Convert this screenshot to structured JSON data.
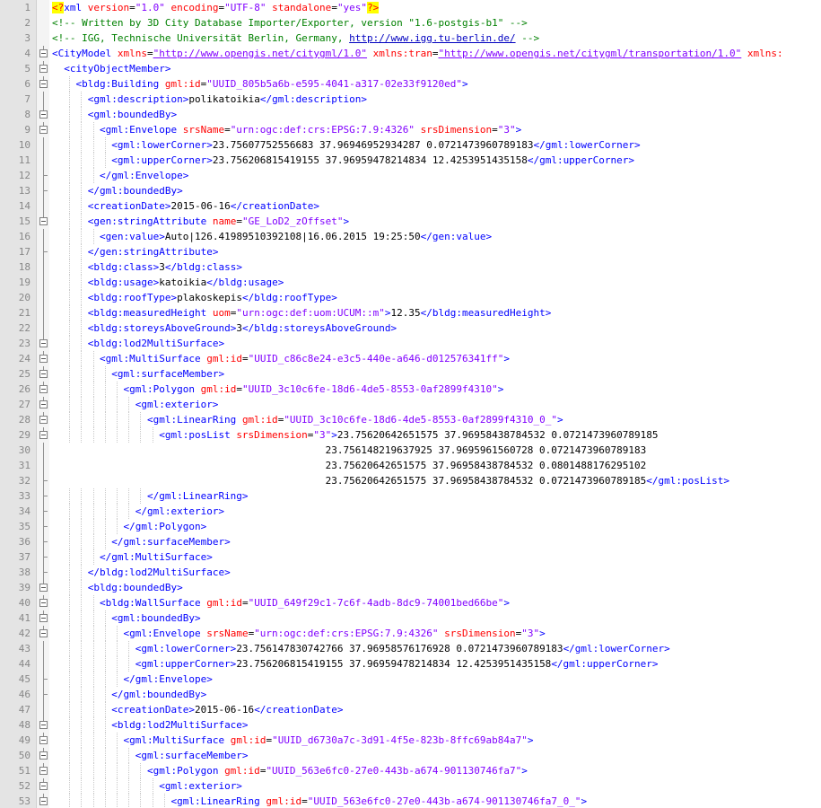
{
  "editor": {
    "lines": [
      {
        "n": "1",
        "fold": "",
        "indent": 0,
        "tokens": [
          {
            "t": "pi",
            "v": "<?"
          },
          {
            "t": "tag",
            "v": "xml "
          },
          {
            "t": "attr",
            "v": "version"
          },
          {
            "t": "txt",
            "v": "="
          },
          {
            "t": "val",
            "v": "\"1.0\""
          },
          {
            "t": "attr",
            "v": " encoding"
          },
          {
            "t": "txt",
            "v": "="
          },
          {
            "t": "val",
            "v": "\"UTF-8\""
          },
          {
            "t": "attr",
            "v": " standalone"
          },
          {
            "t": "txt",
            "v": "="
          },
          {
            "t": "val",
            "v": "\"yes\""
          },
          {
            "t": "pi",
            "v": "?>"
          }
        ]
      },
      {
        "n": "2",
        "fold": "",
        "indent": 0,
        "tokens": [
          {
            "t": "com",
            "v": "<!-- Written by 3D City Database Importer/Exporter, version \"1.6-postgis-b1\" -->"
          }
        ]
      },
      {
        "n": "3",
        "fold": "",
        "indent": 0,
        "tokens": [
          {
            "t": "com",
            "v": "<!-- IGG, Technische Universität Berlin, Germany, "
          },
          {
            "t": "curl",
            "v": "http://www.igg.tu-berlin.de/"
          },
          {
            "t": "com",
            "v": " -->"
          }
        ]
      },
      {
        "n": "4",
        "fold": "box",
        "indent": 0,
        "tokens": [
          {
            "t": "tag",
            "v": "<CityModel "
          },
          {
            "t": "attr",
            "v": "xmlns"
          },
          {
            "t": "txt",
            "v": "="
          },
          {
            "t": "url",
            "v": "\"http://www.opengis.net/citygml/1.0\""
          },
          {
            "t": "attr",
            "v": " xmlns:tran"
          },
          {
            "t": "txt",
            "v": "="
          },
          {
            "t": "url",
            "v": "\"http://www.opengis.net/citygml/transportation/1.0\""
          },
          {
            "t": "attr",
            "v": " xmlns:"
          }
        ]
      },
      {
        "n": "5",
        "fold": "box",
        "indent": 1,
        "tokens": [
          {
            "t": "tag",
            "v": "<cityObjectMember>"
          }
        ]
      },
      {
        "n": "6",
        "fold": "box",
        "indent": 2,
        "tokens": [
          {
            "t": "tag",
            "v": "<bldg:Building "
          },
          {
            "t": "attr",
            "v": "gml:id"
          },
          {
            "t": "txt",
            "v": "="
          },
          {
            "t": "val",
            "v": "\"UUID_805b5a6b-e595-4041-a317-02e33f9120ed\""
          },
          {
            "t": "tag",
            "v": ">"
          }
        ]
      },
      {
        "n": "7",
        "fold": "line",
        "indent": 3,
        "tokens": [
          {
            "t": "tag",
            "v": "<gml:description>"
          },
          {
            "t": "txt",
            "v": "polikatoikia"
          },
          {
            "t": "tag",
            "v": "</gml:description>"
          }
        ]
      },
      {
        "n": "8",
        "fold": "box",
        "indent": 3,
        "tokens": [
          {
            "t": "tag",
            "v": "<gml:boundedBy>"
          }
        ]
      },
      {
        "n": "9",
        "fold": "box",
        "indent": 4,
        "tokens": [
          {
            "t": "tag",
            "v": "<gml:Envelope "
          },
          {
            "t": "attr",
            "v": "srsName"
          },
          {
            "t": "txt",
            "v": "="
          },
          {
            "t": "val",
            "v": "\"urn:ogc:def:crs:EPSG:7.9:4326\""
          },
          {
            "t": "attr",
            "v": " srsDimension"
          },
          {
            "t": "txt",
            "v": "="
          },
          {
            "t": "val",
            "v": "\"3\""
          },
          {
            "t": "tag",
            "v": ">"
          }
        ]
      },
      {
        "n": "10",
        "fold": "line",
        "indent": 5,
        "tokens": [
          {
            "t": "tag",
            "v": "<gml:lowerCorner>"
          },
          {
            "t": "txt",
            "v": "23.75607752556683 37.96946952934287 0.0721473960789183"
          },
          {
            "t": "tag",
            "v": "</gml:lowerCorner>"
          }
        ]
      },
      {
        "n": "11",
        "fold": "line",
        "indent": 5,
        "tokens": [
          {
            "t": "tag",
            "v": "<gml:upperCorner>"
          },
          {
            "t": "txt",
            "v": "23.756206815419155 37.96959478214834 12.4253951435158"
          },
          {
            "t": "tag",
            "v": "</gml:upperCorner>"
          }
        ]
      },
      {
        "n": "12",
        "fold": "end",
        "indent": 4,
        "tokens": [
          {
            "t": "tag",
            "v": "</gml:Envelope>"
          }
        ]
      },
      {
        "n": "13",
        "fold": "end",
        "indent": 3,
        "tokens": [
          {
            "t": "tag",
            "v": "</gml:boundedBy>"
          }
        ]
      },
      {
        "n": "14",
        "fold": "line",
        "indent": 3,
        "tokens": [
          {
            "t": "tag",
            "v": "<creationDate>"
          },
          {
            "t": "txt",
            "v": "2015-06-16"
          },
          {
            "t": "tag",
            "v": "</creationDate>"
          }
        ]
      },
      {
        "n": "15",
        "fold": "box",
        "indent": 3,
        "tokens": [
          {
            "t": "tag",
            "v": "<gen:stringAttribute "
          },
          {
            "t": "attr",
            "v": "name"
          },
          {
            "t": "txt",
            "v": "="
          },
          {
            "t": "val",
            "v": "\"GE_LoD2_zOffset\""
          },
          {
            "t": "tag",
            "v": ">"
          }
        ]
      },
      {
        "n": "16",
        "fold": "line",
        "indent": 4,
        "tokens": [
          {
            "t": "tag",
            "v": "<gen:value>"
          },
          {
            "t": "txt",
            "v": "Auto|126.41989510392108|16.06.2015 19:25:50"
          },
          {
            "t": "tag",
            "v": "</gen:value>"
          }
        ]
      },
      {
        "n": "17",
        "fold": "end",
        "indent": 3,
        "tokens": [
          {
            "t": "tag",
            "v": "</gen:stringAttribute>"
          }
        ]
      },
      {
        "n": "18",
        "fold": "line",
        "indent": 3,
        "tokens": [
          {
            "t": "tag",
            "v": "<bldg:class>"
          },
          {
            "t": "txt",
            "v": "3"
          },
          {
            "t": "tag",
            "v": "</bldg:class>"
          }
        ]
      },
      {
        "n": "19",
        "fold": "line",
        "indent": 3,
        "tokens": [
          {
            "t": "tag",
            "v": "<bldg:usage>"
          },
          {
            "t": "txt",
            "v": "katoikia"
          },
          {
            "t": "tag",
            "v": "</bldg:usage>"
          }
        ]
      },
      {
        "n": "20",
        "fold": "line",
        "indent": 3,
        "tokens": [
          {
            "t": "tag",
            "v": "<bldg:roofType>"
          },
          {
            "t": "txt",
            "v": "plakoskepis"
          },
          {
            "t": "tag",
            "v": "</bldg:roofType>"
          }
        ]
      },
      {
        "n": "21",
        "fold": "line",
        "indent": 3,
        "tokens": [
          {
            "t": "tag",
            "v": "<bldg:measuredHeight "
          },
          {
            "t": "attr",
            "v": "uom"
          },
          {
            "t": "txt",
            "v": "="
          },
          {
            "t": "val",
            "v": "\"urn:ogc:def:uom:UCUM::m\""
          },
          {
            "t": "tag",
            "v": ">"
          },
          {
            "t": "txt",
            "v": "12.35"
          },
          {
            "t": "tag",
            "v": "</bldg:measuredHeight>"
          }
        ]
      },
      {
        "n": "22",
        "fold": "line",
        "indent": 3,
        "tokens": [
          {
            "t": "tag",
            "v": "<bldg:storeysAboveGround>"
          },
          {
            "t": "txt",
            "v": "3"
          },
          {
            "t": "tag",
            "v": "</bldg:storeysAboveGround>"
          }
        ]
      },
      {
        "n": "23",
        "fold": "box",
        "indent": 3,
        "tokens": [
          {
            "t": "tag",
            "v": "<bldg:lod2MultiSurface>"
          }
        ]
      },
      {
        "n": "24",
        "fold": "box",
        "indent": 4,
        "tokens": [
          {
            "t": "tag",
            "v": "<gml:MultiSurface "
          },
          {
            "t": "attr",
            "v": "gml:id"
          },
          {
            "t": "txt",
            "v": "="
          },
          {
            "t": "val",
            "v": "\"UUID_c86c8e24-e3c5-440e-a646-d012576341ff\""
          },
          {
            "t": "tag",
            "v": ">"
          }
        ]
      },
      {
        "n": "25",
        "fold": "box",
        "indent": 5,
        "tokens": [
          {
            "t": "tag",
            "v": "<gml:surfaceMember>"
          }
        ]
      },
      {
        "n": "26",
        "fold": "box",
        "indent": 6,
        "tokens": [
          {
            "t": "tag",
            "v": "<gml:Polygon "
          },
          {
            "t": "attr",
            "v": "gml:id"
          },
          {
            "t": "txt",
            "v": "="
          },
          {
            "t": "val",
            "v": "\"UUID_3c10c6fe-18d6-4de5-8553-0af2899f4310\""
          },
          {
            "t": "tag",
            "v": ">"
          }
        ]
      },
      {
        "n": "27",
        "fold": "box",
        "indent": 7,
        "tokens": [
          {
            "t": "tag",
            "v": "<gml:exterior>"
          }
        ]
      },
      {
        "n": "28",
        "fold": "box",
        "indent": 8,
        "tokens": [
          {
            "t": "tag",
            "v": "<gml:LinearRing "
          },
          {
            "t": "attr",
            "v": "gml:id"
          },
          {
            "t": "txt",
            "v": "="
          },
          {
            "t": "val",
            "v": "\"UUID_3c10c6fe-18d6-4de5-8553-0af2899f4310_0_\""
          },
          {
            "t": "tag",
            "v": ">"
          }
        ]
      },
      {
        "n": "29",
        "fold": "box",
        "indent": 9,
        "tokens": [
          {
            "t": "tag",
            "v": "<gml:posList "
          },
          {
            "t": "attr",
            "v": "srsDimension"
          },
          {
            "t": "txt",
            "v": "="
          },
          {
            "t": "val",
            "v": "\"3\""
          },
          {
            "t": "tag",
            "v": ">"
          },
          {
            "t": "txt",
            "v": "23.75620642651575 37.96958438784532 0.0721473960789185"
          }
        ]
      },
      {
        "n": "30",
        "fold": "line",
        "indent": 0,
        "pad": "                                              ",
        "tokens": [
          {
            "t": "txt",
            "v": "23.756148219637925 37.9695961560728 0.0721473960789183"
          }
        ]
      },
      {
        "n": "31",
        "fold": "line",
        "indent": 0,
        "pad": "                                              ",
        "tokens": [
          {
            "t": "txt",
            "v": "23.75620642651575 37.96958438784532 0.0801488176295102"
          }
        ]
      },
      {
        "n": "32",
        "fold": "end",
        "indent": 0,
        "pad": "                                              ",
        "tokens": [
          {
            "t": "txt",
            "v": "23.75620642651575 37.96958438784532 0.0721473960789185"
          },
          {
            "t": "tag",
            "v": "</gml:posList>"
          }
        ]
      },
      {
        "n": "33",
        "fold": "end",
        "indent": 8,
        "tokens": [
          {
            "t": "tag",
            "v": "</gml:LinearRing>"
          }
        ]
      },
      {
        "n": "34",
        "fold": "end",
        "indent": 7,
        "tokens": [
          {
            "t": "tag",
            "v": "</gml:exterior>"
          }
        ]
      },
      {
        "n": "35",
        "fold": "end",
        "indent": 6,
        "tokens": [
          {
            "t": "tag",
            "v": "</gml:Polygon>"
          }
        ]
      },
      {
        "n": "36",
        "fold": "end",
        "indent": 5,
        "tokens": [
          {
            "t": "tag",
            "v": "</gml:surfaceMember>"
          }
        ]
      },
      {
        "n": "37",
        "fold": "end",
        "indent": 4,
        "tokens": [
          {
            "t": "tag",
            "v": "</gml:MultiSurface>"
          }
        ]
      },
      {
        "n": "38",
        "fold": "end",
        "indent": 3,
        "tokens": [
          {
            "t": "tag",
            "v": "</bldg:lod2MultiSurface>"
          }
        ]
      },
      {
        "n": "39",
        "fold": "box",
        "indent": 3,
        "tokens": [
          {
            "t": "tag",
            "v": "<bldg:boundedBy>"
          }
        ]
      },
      {
        "n": "40",
        "fold": "box",
        "indent": 4,
        "tokens": [
          {
            "t": "tag",
            "v": "<bldg:WallSurface "
          },
          {
            "t": "attr",
            "v": "gml:id"
          },
          {
            "t": "txt",
            "v": "="
          },
          {
            "t": "val",
            "v": "\"UUID_649f29c1-7c6f-4adb-8dc9-74001bed66be\""
          },
          {
            "t": "tag",
            "v": ">"
          }
        ]
      },
      {
        "n": "41",
        "fold": "box",
        "indent": 5,
        "tokens": [
          {
            "t": "tag",
            "v": "<gml:boundedBy>"
          }
        ]
      },
      {
        "n": "42",
        "fold": "box",
        "indent": 6,
        "tokens": [
          {
            "t": "tag",
            "v": "<gml:Envelope "
          },
          {
            "t": "attr",
            "v": "srsName"
          },
          {
            "t": "txt",
            "v": "="
          },
          {
            "t": "val",
            "v": "\"urn:ogc:def:crs:EPSG:7.9:4326\""
          },
          {
            "t": "attr",
            "v": " srsDimension"
          },
          {
            "t": "txt",
            "v": "="
          },
          {
            "t": "val",
            "v": "\"3\""
          },
          {
            "t": "tag",
            "v": ">"
          }
        ]
      },
      {
        "n": "43",
        "fold": "line",
        "indent": 7,
        "tokens": [
          {
            "t": "tag",
            "v": "<gml:lowerCorner>"
          },
          {
            "t": "txt",
            "v": "23.756147830742766 37.96958576176928 0.0721473960789183"
          },
          {
            "t": "tag",
            "v": "</gml:lowerCorner>"
          }
        ]
      },
      {
        "n": "44",
        "fold": "line",
        "indent": 7,
        "tokens": [
          {
            "t": "tag",
            "v": "<gml:upperCorner>"
          },
          {
            "t": "txt",
            "v": "23.756206815419155 37.96959478214834 12.4253951435158"
          },
          {
            "t": "tag",
            "v": "</gml:upperCorner>"
          }
        ]
      },
      {
        "n": "45",
        "fold": "end",
        "indent": 6,
        "tokens": [
          {
            "t": "tag",
            "v": "</gml:Envelope>"
          }
        ]
      },
      {
        "n": "46",
        "fold": "end",
        "indent": 5,
        "tokens": [
          {
            "t": "tag",
            "v": "</gml:boundedBy>"
          }
        ]
      },
      {
        "n": "47",
        "fold": "line",
        "indent": 5,
        "tokens": [
          {
            "t": "tag",
            "v": "<creationDate>"
          },
          {
            "t": "txt",
            "v": "2015-06-16"
          },
          {
            "t": "tag",
            "v": "</creationDate>"
          }
        ]
      },
      {
        "n": "48",
        "fold": "box",
        "indent": 5,
        "tokens": [
          {
            "t": "tag",
            "v": "<bldg:lod2MultiSurface>"
          }
        ]
      },
      {
        "n": "49",
        "fold": "box",
        "indent": 6,
        "tokens": [
          {
            "t": "tag",
            "v": "<gml:MultiSurface "
          },
          {
            "t": "attr",
            "v": "gml:id"
          },
          {
            "t": "txt",
            "v": "="
          },
          {
            "t": "val",
            "v": "\"UUID_d6730a7c-3d91-4f5e-823b-8ffc69ab84a7\""
          },
          {
            "t": "tag",
            "v": ">"
          }
        ]
      },
      {
        "n": "50",
        "fold": "box",
        "indent": 7,
        "tokens": [
          {
            "t": "tag",
            "v": "<gml:surfaceMember>"
          }
        ]
      },
      {
        "n": "51",
        "fold": "box",
        "indent": 8,
        "tokens": [
          {
            "t": "tag",
            "v": "<gml:Polygon "
          },
          {
            "t": "attr",
            "v": "gml:id"
          },
          {
            "t": "txt",
            "v": "="
          },
          {
            "t": "val",
            "v": "\"UUID_563e6fc0-27e0-443b-a674-901130746fa7\""
          },
          {
            "t": "tag",
            "v": ">"
          }
        ]
      },
      {
        "n": "52",
        "fold": "box",
        "indent": 9,
        "tokens": [
          {
            "t": "tag",
            "v": "<gml:exterior>"
          }
        ]
      },
      {
        "n": "53",
        "fold": "box",
        "indent": 10,
        "tokens": [
          {
            "t": "tag",
            "v": "<gml:LinearRing "
          },
          {
            "t": "attr",
            "v": "gml:id"
          },
          {
            "t": "txt",
            "v": "="
          },
          {
            "t": "val",
            "v": "\"UUID_563e6fc0-27e0-443b-a674-901130746fa7_0_\""
          },
          {
            "t": "tag",
            "v": ">"
          }
        ]
      }
    ]
  }
}
